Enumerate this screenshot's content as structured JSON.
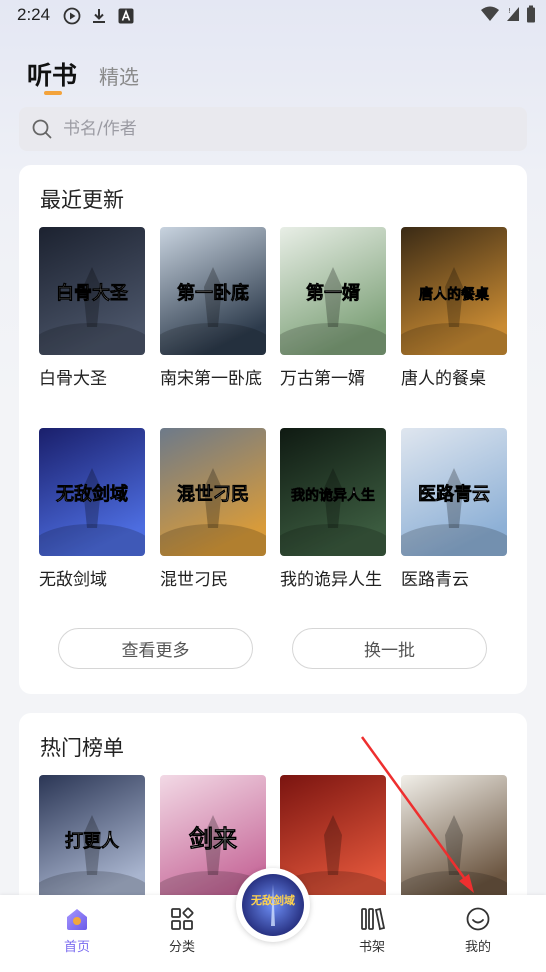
{
  "status_bar": {
    "time": "2:24",
    "icons": [
      "play-circle-icon",
      "download-icon",
      "font-a-icon",
      "wifi-icon",
      "signal-icon",
      "battery-icon"
    ]
  },
  "top_tabs": [
    {
      "label": "听书",
      "active": true
    },
    {
      "label": "精选",
      "active": false
    }
  ],
  "search": {
    "placeholder": "书名/作者"
  },
  "recent": {
    "title": "最近更新",
    "books": [
      {
        "name": "白骨大圣",
        "cover_text": "白骨大圣",
        "colors": [
          "#1c2230",
          "#4a5468"
        ]
      },
      {
        "name": "南宋第一卧底",
        "cover_text": "第一卧底",
        "colors": [
          "#c8d3df",
          "#2d3b4c"
        ]
      },
      {
        "name": "万古第一婿",
        "cover_text": "第一婿",
        "colors": [
          "#e8eee6",
          "#7fa27a"
        ]
      },
      {
        "name": "唐人的餐桌",
        "cover_text": "唐人的餐桌",
        "colors": [
          "#3a2a15",
          "#c98b33"
        ]
      },
      {
        "name": "无敌剑域",
        "cover_text": "无敌剑域",
        "colors": [
          "#1a1f6b",
          "#4d6de0"
        ]
      },
      {
        "name": "混世刁民",
        "cover_text": "混世刁民",
        "colors": [
          "#6d7a8a",
          "#d89b3a"
        ]
      },
      {
        "name": "我的诡异人生",
        "cover_text": "我的诡异人生",
        "colors": [
          "#0f1a12",
          "#3b5b3f"
        ]
      },
      {
        "name": "医路青云",
        "cover_text": "医路青云",
        "colors": [
          "#dfe6ef",
          "#8db0d6"
        ]
      }
    ],
    "more_button": "查看更多",
    "refresh_button": "换一批"
  },
  "hot": {
    "title": "热门榜单",
    "books": [
      {
        "cover_text": "打更人",
        "colors": [
          "#2b3655",
          "#a9b5cf"
        ]
      },
      {
        "cover_text": "剑来",
        "colors": [
          "#f2d9e5",
          "#c76a9a"
        ]
      },
      {
        "cover_text": "",
        "colors": [
          "#7a1410",
          "#e0553a"
        ]
      },
      {
        "cover_text": "",
        "colors": [
          "#f1efe9",
          "#6b5540"
        ]
      }
    ]
  },
  "bottom_nav": [
    {
      "label": "首页",
      "icon": "home-icon",
      "active": true
    },
    {
      "label": "分类",
      "icon": "category-grid-icon",
      "active": false
    },
    {
      "label": "书架",
      "icon": "bookshelf-icon",
      "active": false
    },
    {
      "label": "我的",
      "icon": "smile-profile-icon",
      "active": false
    }
  ],
  "center_player": {
    "cover_text": "无敌剑域",
    "colors": [
      "#1a1f6b",
      "#4d6de0"
    ]
  },
  "colors": {
    "accent": "#7b6cf0",
    "tab_indicator": "#f3a33b",
    "annotation_arrow": "#ee2f2f"
  }
}
